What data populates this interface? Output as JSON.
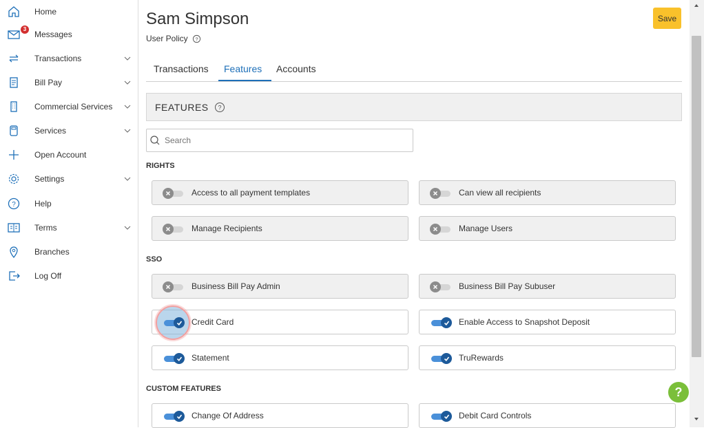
{
  "sidebar": {
    "items": [
      {
        "label": "Home",
        "icon": "home-icon",
        "chevron": false
      },
      {
        "label": "Messages",
        "icon": "mail-icon",
        "chevron": false,
        "badge": "3"
      },
      {
        "label": "Transactions",
        "icon": "transfer-icon",
        "chevron": true
      },
      {
        "label": "Bill Pay",
        "icon": "bill-icon",
        "chevron": true
      },
      {
        "label": "Commercial Services",
        "icon": "building-icon",
        "chevron": true
      },
      {
        "label": "Services",
        "icon": "calculator-icon",
        "chevron": true
      },
      {
        "label": "Open Account",
        "icon": "plus-icon",
        "chevron": false
      },
      {
        "label": "Settings",
        "icon": "gear-icon",
        "chevron": true
      },
      {
        "label": "Help",
        "icon": "help-icon",
        "chevron": false
      },
      {
        "label": "Terms",
        "icon": "terms-icon",
        "chevron": true
      },
      {
        "label": "Branches",
        "icon": "location-icon",
        "chevron": false
      },
      {
        "label": "Log Off",
        "icon": "logoff-icon",
        "chevron": false
      }
    ]
  },
  "header": {
    "title": "Sam Simpson",
    "subtitle": "User Policy",
    "save_label": "Save"
  },
  "tabs": [
    {
      "label": "Transactions",
      "active": false
    },
    {
      "label": "Features",
      "active": true
    },
    {
      "label": "Accounts",
      "active": false
    }
  ],
  "features_panel": {
    "title": "FEATURES"
  },
  "search": {
    "placeholder": "Search",
    "value": ""
  },
  "sections": {
    "rights": {
      "heading": "RIGHTS",
      "items": [
        {
          "label": "Access to all payment templates",
          "enabled": false
        },
        {
          "label": "Can view all recipients",
          "enabled": false
        },
        {
          "label": "Manage Recipients",
          "enabled": false
        },
        {
          "label": "Manage Users",
          "enabled": false
        }
      ]
    },
    "sso": {
      "heading": "SSO",
      "items": [
        {
          "label": "Business Bill Pay Admin",
          "enabled": false
        },
        {
          "label": "Business Bill Pay Subuser",
          "enabled": false
        },
        {
          "label": "Credit Card",
          "enabled": true,
          "focused": true
        },
        {
          "label": "Enable Access to Snapshot Deposit",
          "enabled": true
        },
        {
          "label": "Statement",
          "enabled": true
        },
        {
          "label": "TruRewards",
          "enabled": true
        }
      ]
    },
    "custom": {
      "heading": "CUSTOM FEATURES",
      "items": [
        {
          "label": "Change Of Address",
          "enabled": true
        },
        {
          "label": "Debit Card Controls",
          "enabled": true
        }
      ]
    }
  },
  "help_fab": {
    "label": "?"
  },
  "colors": {
    "accent": "#1d6fb8",
    "save": "#f9c12b",
    "toggle_on": "#1d5a9a",
    "help": "#7bbf3a"
  }
}
